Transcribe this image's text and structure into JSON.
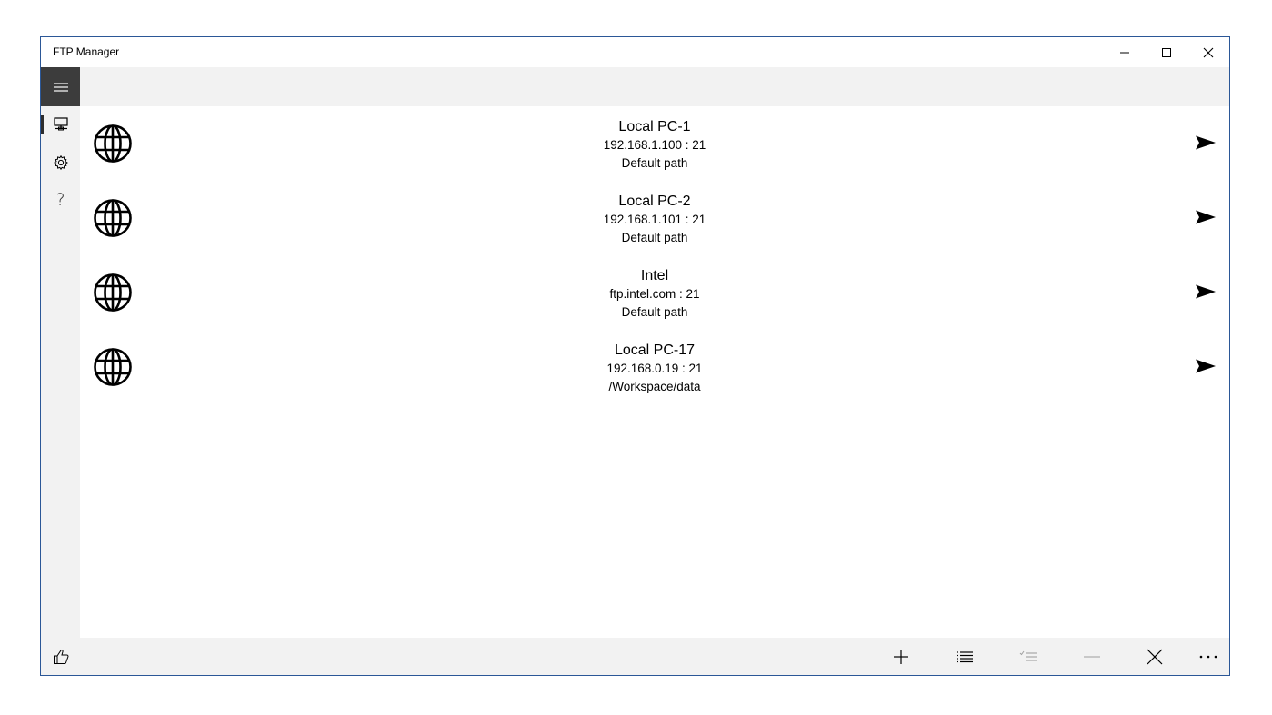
{
  "window": {
    "title": "FTP Manager",
    "controls": [
      "minimize-icon",
      "maximize-icon",
      "close-icon"
    ]
  },
  "sidebar": {
    "menu_icon": "hamburger-icon",
    "items": [
      {
        "icon": "network-pc-icon",
        "selected": true
      },
      {
        "icon": "gear-icon",
        "selected": false
      },
      {
        "icon": "help-icon",
        "label": "?",
        "selected": false
      }
    ],
    "bottom_icon": "thumbs-up-icon"
  },
  "connections": [
    {
      "name": "Local PC-1",
      "address": "192.168.1.100 : 21",
      "path": "Default path"
    },
    {
      "name": "Local PC-2",
      "address": "192.168.1.101 : 21",
      "path": "Default path"
    },
    {
      "name": "Intel",
      "address": "ftp.intel.com : 21",
      "path": "Default path"
    },
    {
      "name": "Local PC-17",
      "address": "192.168.0.19 : 21",
      "path": "/Workspace/data"
    }
  ],
  "toolbar": {
    "buttons": [
      {
        "icon": "add-icon",
        "enabled": true
      },
      {
        "icon": "list-icon",
        "enabled": true
      },
      {
        "icon": "select-list-icon",
        "enabled": false
      },
      {
        "icon": "remove-icon",
        "enabled": false
      },
      {
        "icon": "close-icon",
        "enabled": true
      },
      {
        "icon": "more-icon",
        "enabled": true
      }
    ]
  },
  "colors": {
    "window_border": "#2b5797",
    "hamburger_bg": "#3c3c3c",
    "bar_bg": "#f2f2f2",
    "disabled_icon": "#a0a0a0"
  }
}
